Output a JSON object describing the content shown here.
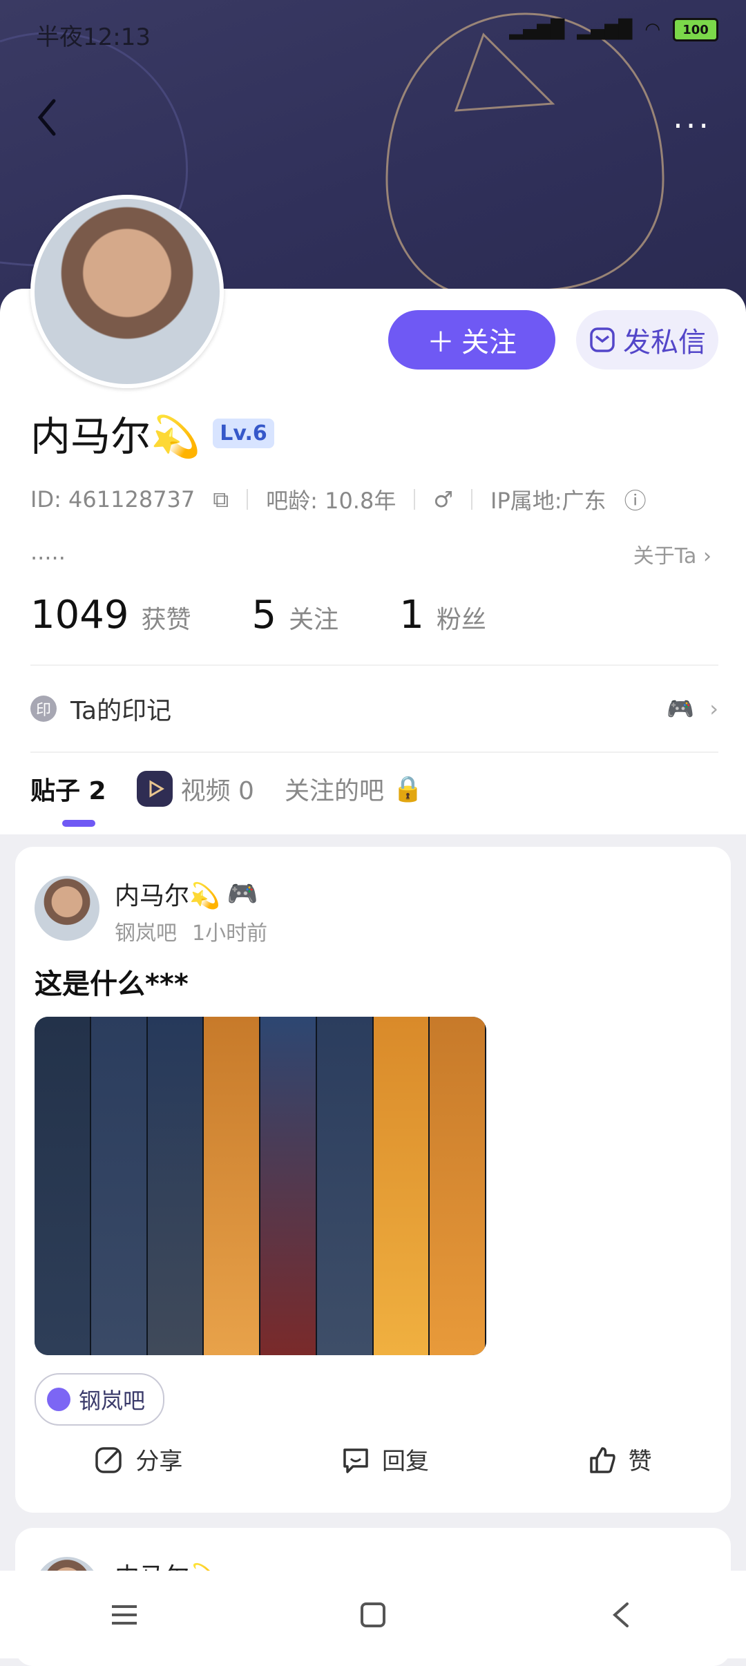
{
  "status_bar": {
    "time": "半夜12:13",
    "battery": "100"
  },
  "header": {
    "more_label": "···"
  },
  "profile": {
    "name": "内马尔💫",
    "level": "Lv.6",
    "id_text": "ID: 461128737",
    "age_text": "吧龄: 10.8年",
    "gender": "♂",
    "ip_text": "IP属地:广东",
    "bio": ".....",
    "about_label": "关于Ta",
    "follow_label": "关注",
    "message_label": "发私信"
  },
  "stats": [
    {
      "value": "1049",
      "label": "获赞"
    },
    {
      "value": "5",
      "label": "关注"
    },
    {
      "value": "1",
      "label": "粉丝"
    }
  ],
  "marks": {
    "badge": "印",
    "label": "Ta的印记"
  },
  "tabs": [
    {
      "label": "贴子 2"
    },
    {
      "label": "视频 0"
    },
    {
      "label": "关注的吧"
    }
  ],
  "post": {
    "author": "内马尔💫",
    "forum_name": "钢岚吧",
    "time": "1小时前",
    "title": "这是什么***",
    "forum_tag": "钢岚吧",
    "share_label": "分享",
    "reply_label": "回复",
    "like_label": "赞"
  },
  "post2": {
    "author": "内马尔💫"
  },
  "colors": {
    "accent": "#6f59f4",
    "banner": "#32325a"
  }
}
